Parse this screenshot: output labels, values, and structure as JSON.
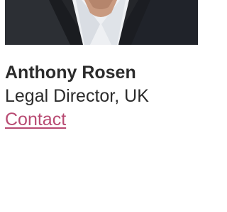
{
  "profile": {
    "name": "Anthony Rosen",
    "title": "Legal Director, UK",
    "contact_label": "Contact"
  },
  "colors": {
    "text": "#2b2b2b",
    "link": "#b84a72",
    "photo_background": "#2a2c30"
  }
}
